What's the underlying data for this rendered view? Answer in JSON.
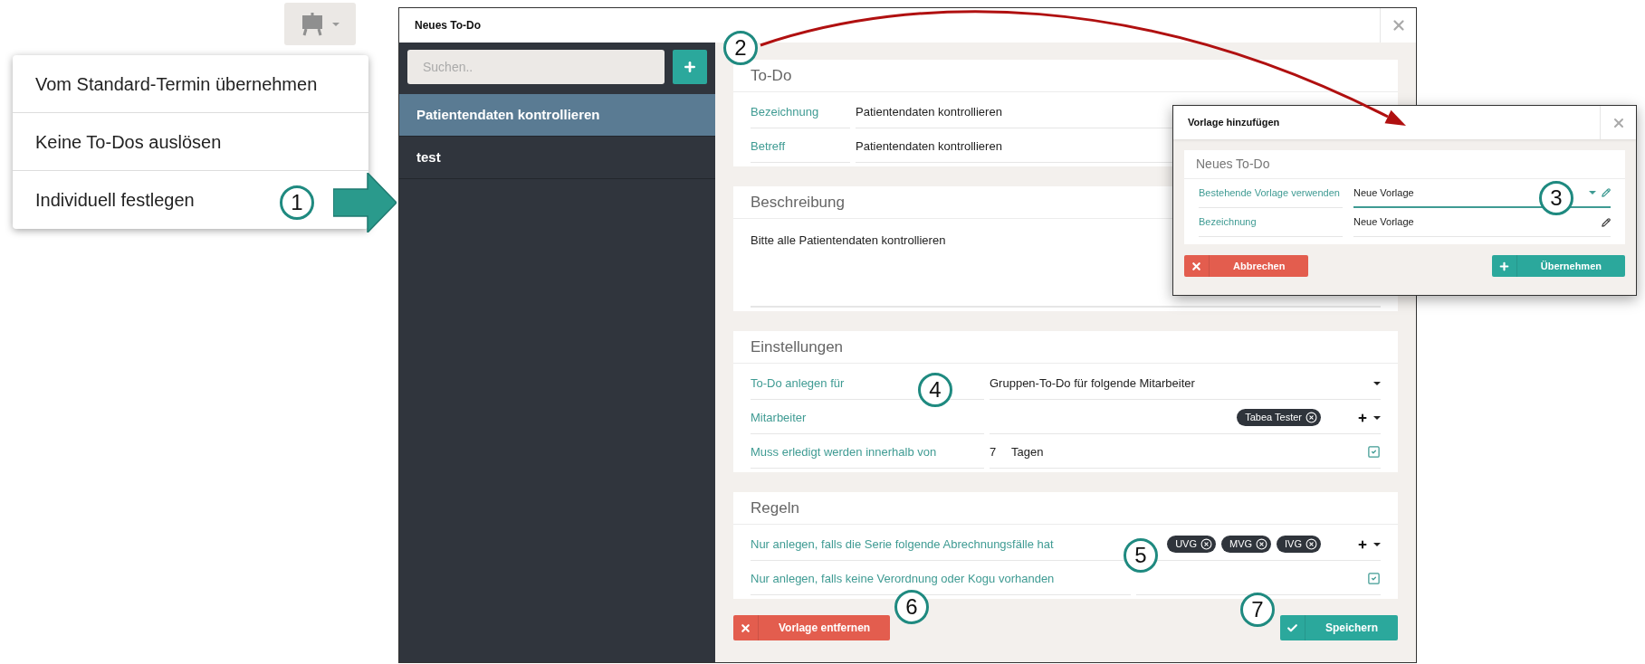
{
  "menu": {
    "items": [
      {
        "label": "Vom Standard-Termin übernehmen"
      },
      {
        "label": "Keine To-Dos auslösen"
      },
      {
        "label": "Individuell festlegen"
      }
    ]
  },
  "dialog": {
    "title": "Neues To-Do",
    "search": {
      "placeholder": "Suchen.."
    },
    "templates": [
      {
        "label": "Patientendaten kontrollieren",
        "selected": true
      },
      {
        "label": "test",
        "selected": false
      }
    ],
    "sections": [
      {
        "title": "To-Do",
        "rows": [
          {
            "kind": "text",
            "label": "Bezeichnung",
            "value": "Patientendaten kontrollieren"
          },
          {
            "kind": "text",
            "label": "Betreff",
            "value": "Patientendaten kontrollieren"
          }
        ]
      },
      {
        "title": "Beschreibung",
        "rows": [
          {
            "kind": "textarea",
            "value": "Bitte alle Patientendaten kontrollieren"
          }
        ]
      },
      {
        "title": "Einstellungen",
        "rows": [
          {
            "kind": "select",
            "label": "To-Do anlegen für",
            "value": "Gruppen-To-Do für folgende Mitarbeiter"
          },
          {
            "kind": "tags",
            "label": "Mitarbeiter",
            "tags": [
              "Tabea Tester"
            ]
          },
          {
            "kind": "days",
            "label": "Muss erledigt werden innerhalb von",
            "value": "7",
            "unit": "Tagen",
            "checked": true
          }
        ]
      },
      {
        "title": "Regeln",
        "rows": [
          {
            "kind": "tags",
            "label": "Nur anlegen, falls die Serie folgende Abrechnungsfälle hat",
            "tags": [
              "UVG",
              "MVG",
              "IVG"
            ]
          },
          {
            "kind": "check",
            "label": "Nur anlegen, falls keine Verordnung oder Kogu vorhanden",
            "checked": true
          }
        ]
      }
    ],
    "buttons": [
      {
        "kind": "danger",
        "label": "Vorlage entfernen"
      },
      {
        "kind": "primary",
        "label": "Speichern"
      }
    ]
  },
  "popup": {
    "title": "Vorlage hinzufügen",
    "section_title": "Neues To-Do",
    "rows": [
      {
        "kind": "select",
        "label": "Bestehende Vorlage verwenden",
        "value": "Neue Vorlage",
        "focused": true
      },
      {
        "kind": "text",
        "label": "Bezeichnung",
        "value": "Neue Vorlage",
        "focused": false
      }
    ],
    "buttons": [
      {
        "kind": "danger",
        "label": "Abbrechen"
      },
      {
        "kind": "primary",
        "label": "Übernehmen"
      }
    ]
  },
  "callouts": [
    "1",
    "2",
    "3",
    "4",
    "5",
    "6",
    "7"
  ]
}
